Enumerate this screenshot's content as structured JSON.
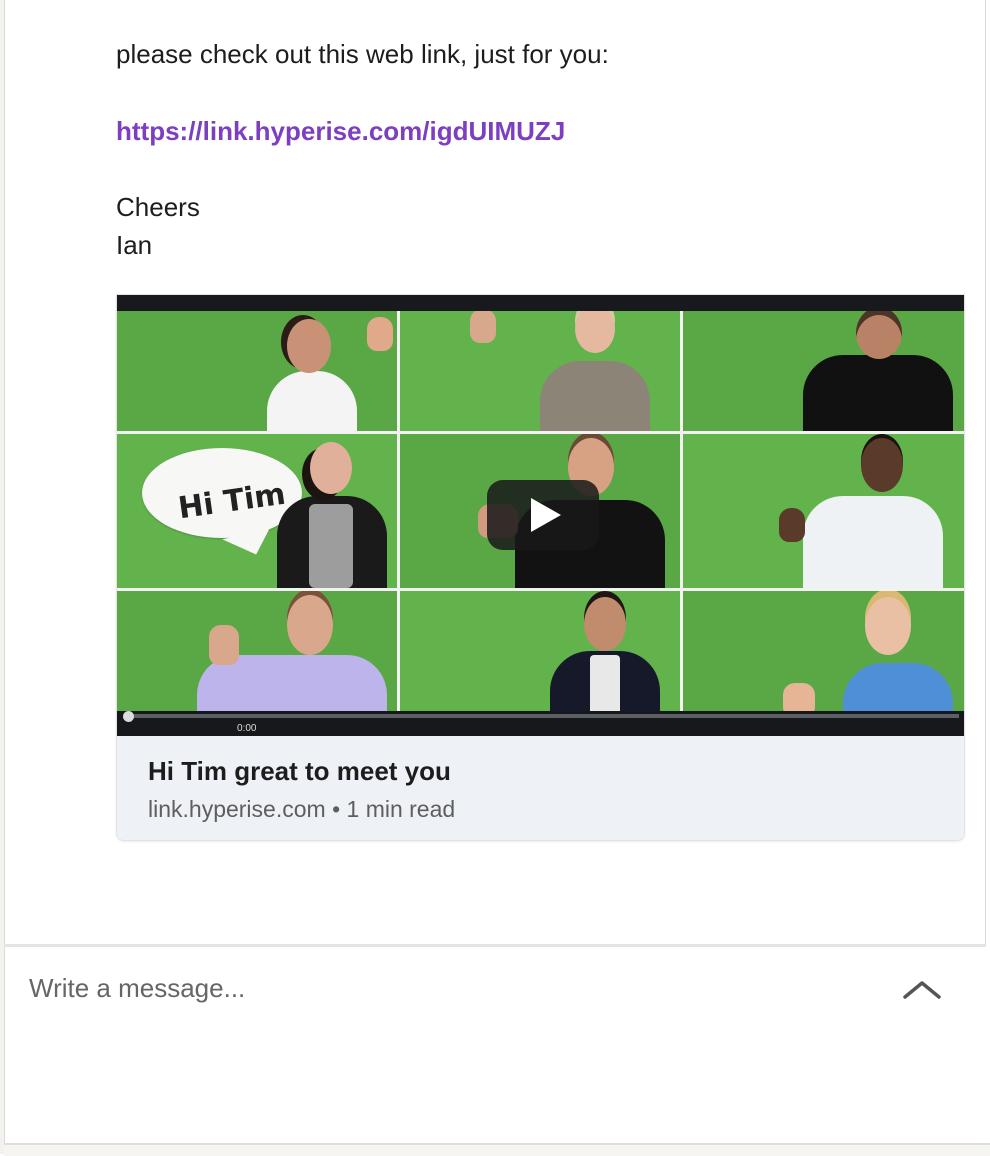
{
  "message": {
    "line_intro": "please check out this web link, just for you:",
    "link_text": "https://link.hyperise.com/igdUIMUZJ",
    "sign_off": "Cheers",
    "signature": "Ian"
  },
  "link_preview": {
    "thumbnail_bubble_text": "Hi Tim",
    "video_time": "0:00",
    "title": "Hi Tim great to meet you",
    "meta": "link.hyperise.com • 1 min read"
  },
  "composer": {
    "placeholder": "Write a message..."
  },
  "icons": {
    "play": "play-icon",
    "expand": "chevron-up-icon"
  },
  "colors": {
    "link": "#7d3fc2",
    "green_screen": "#5aa845",
    "card_background": "#eef1f5"
  }
}
